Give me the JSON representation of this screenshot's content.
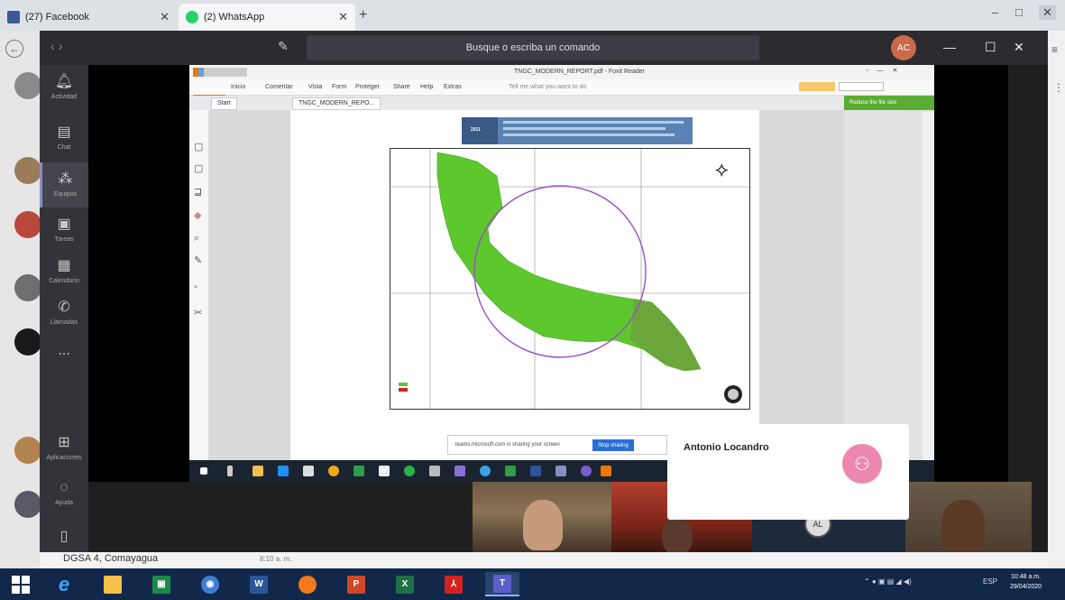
{
  "browser": {
    "tabs": [
      {
        "label": "(27) Facebook",
        "color": "#3b5998"
      },
      {
        "label": "(2) WhatsApp",
        "color": "#25d366"
      }
    ],
    "new_tab": "+",
    "controls": [
      "–",
      "□",
      "✕"
    ]
  },
  "teams": {
    "search_placeholder": "Busque o escriba un comando",
    "profile_initials": "AC",
    "nav": [
      "‹",
      "›"
    ],
    "rail": [
      {
        "icon": "bell",
        "label": "Actividad"
      },
      {
        "icon": "chat",
        "label": "Chat"
      },
      {
        "icon": "teams",
        "label": "Equipos"
      },
      {
        "icon": "tasks",
        "label": "Tareas"
      },
      {
        "icon": "calendar",
        "label": "Calendario"
      },
      {
        "icon": "phone",
        "label": "Llamadas"
      },
      {
        "icon": "more",
        "label": "..."
      },
      {
        "icon": "apps",
        "label": "Aplicaciones"
      },
      {
        "icon": "help",
        "label": "Ayuda"
      }
    ]
  },
  "reader": {
    "title": "TNGC_MODERN_REPORT.pdf - Foxit Reader",
    "menu": [
      "Inicio",
      "Comentar",
      "Vista",
      "Form",
      "Proteger",
      "Share",
      "Help",
      "Extras"
    ],
    "tell_me": "Tell me what you want to do",
    "tabs": [
      "Start",
      "TNGC_MODERN_REPO..."
    ],
    "right_panel": "Reduce the file size",
    "title_block_code": "2011"
  },
  "share_banner": {
    "text": "teams.microsoft.com is sharing your screen",
    "stop_label": "Stop sharing"
  },
  "participant": {
    "name": "Antonio Locandro",
    "video_initials": "AL"
  },
  "chat": {
    "channel": "DGSA 4, Comayagua",
    "time": "8:10 a. m."
  },
  "taskbar": {
    "apps": [
      {
        "icon": "windows-logo"
      },
      {
        "icon": "ie-icon"
      },
      {
        "icon": "folder-icon"
      },
      {
        "icon": "store-icon"
      },
      {
        "icon": "skype-icon"
      },
      {
        "icon": "word-icon",
        "letter": "W"
      },
      {
        "icon": "firefox-icon"
      },
      {
        "icon": "powerpoint-icon",
        "letter": "P"
      },
      {
        "icon": "excel-icon",
        "letter": "X"
      },
      {
        "icon": "acrobat-icon"
      },
      {
        "icon": "teams-icon",
        "letter": "T"
      }
    ],
    "language": "ESP",
    "time": "10:48 a.m.",
    "date": "29/04/2020"
  },
  "colors": {
    "teams_dark": "#2b2b30",
    "rail": "#33333a",
    "accent_purple": "#8b8cc7",
    "taskbar": "#12284b",
    "foxit_orange": "#f0760a",
    "map_green": "#5cc82e",
    "circle": "#9b4fc2",
    "avatar_pink": "#ec88b0"
  }
}
